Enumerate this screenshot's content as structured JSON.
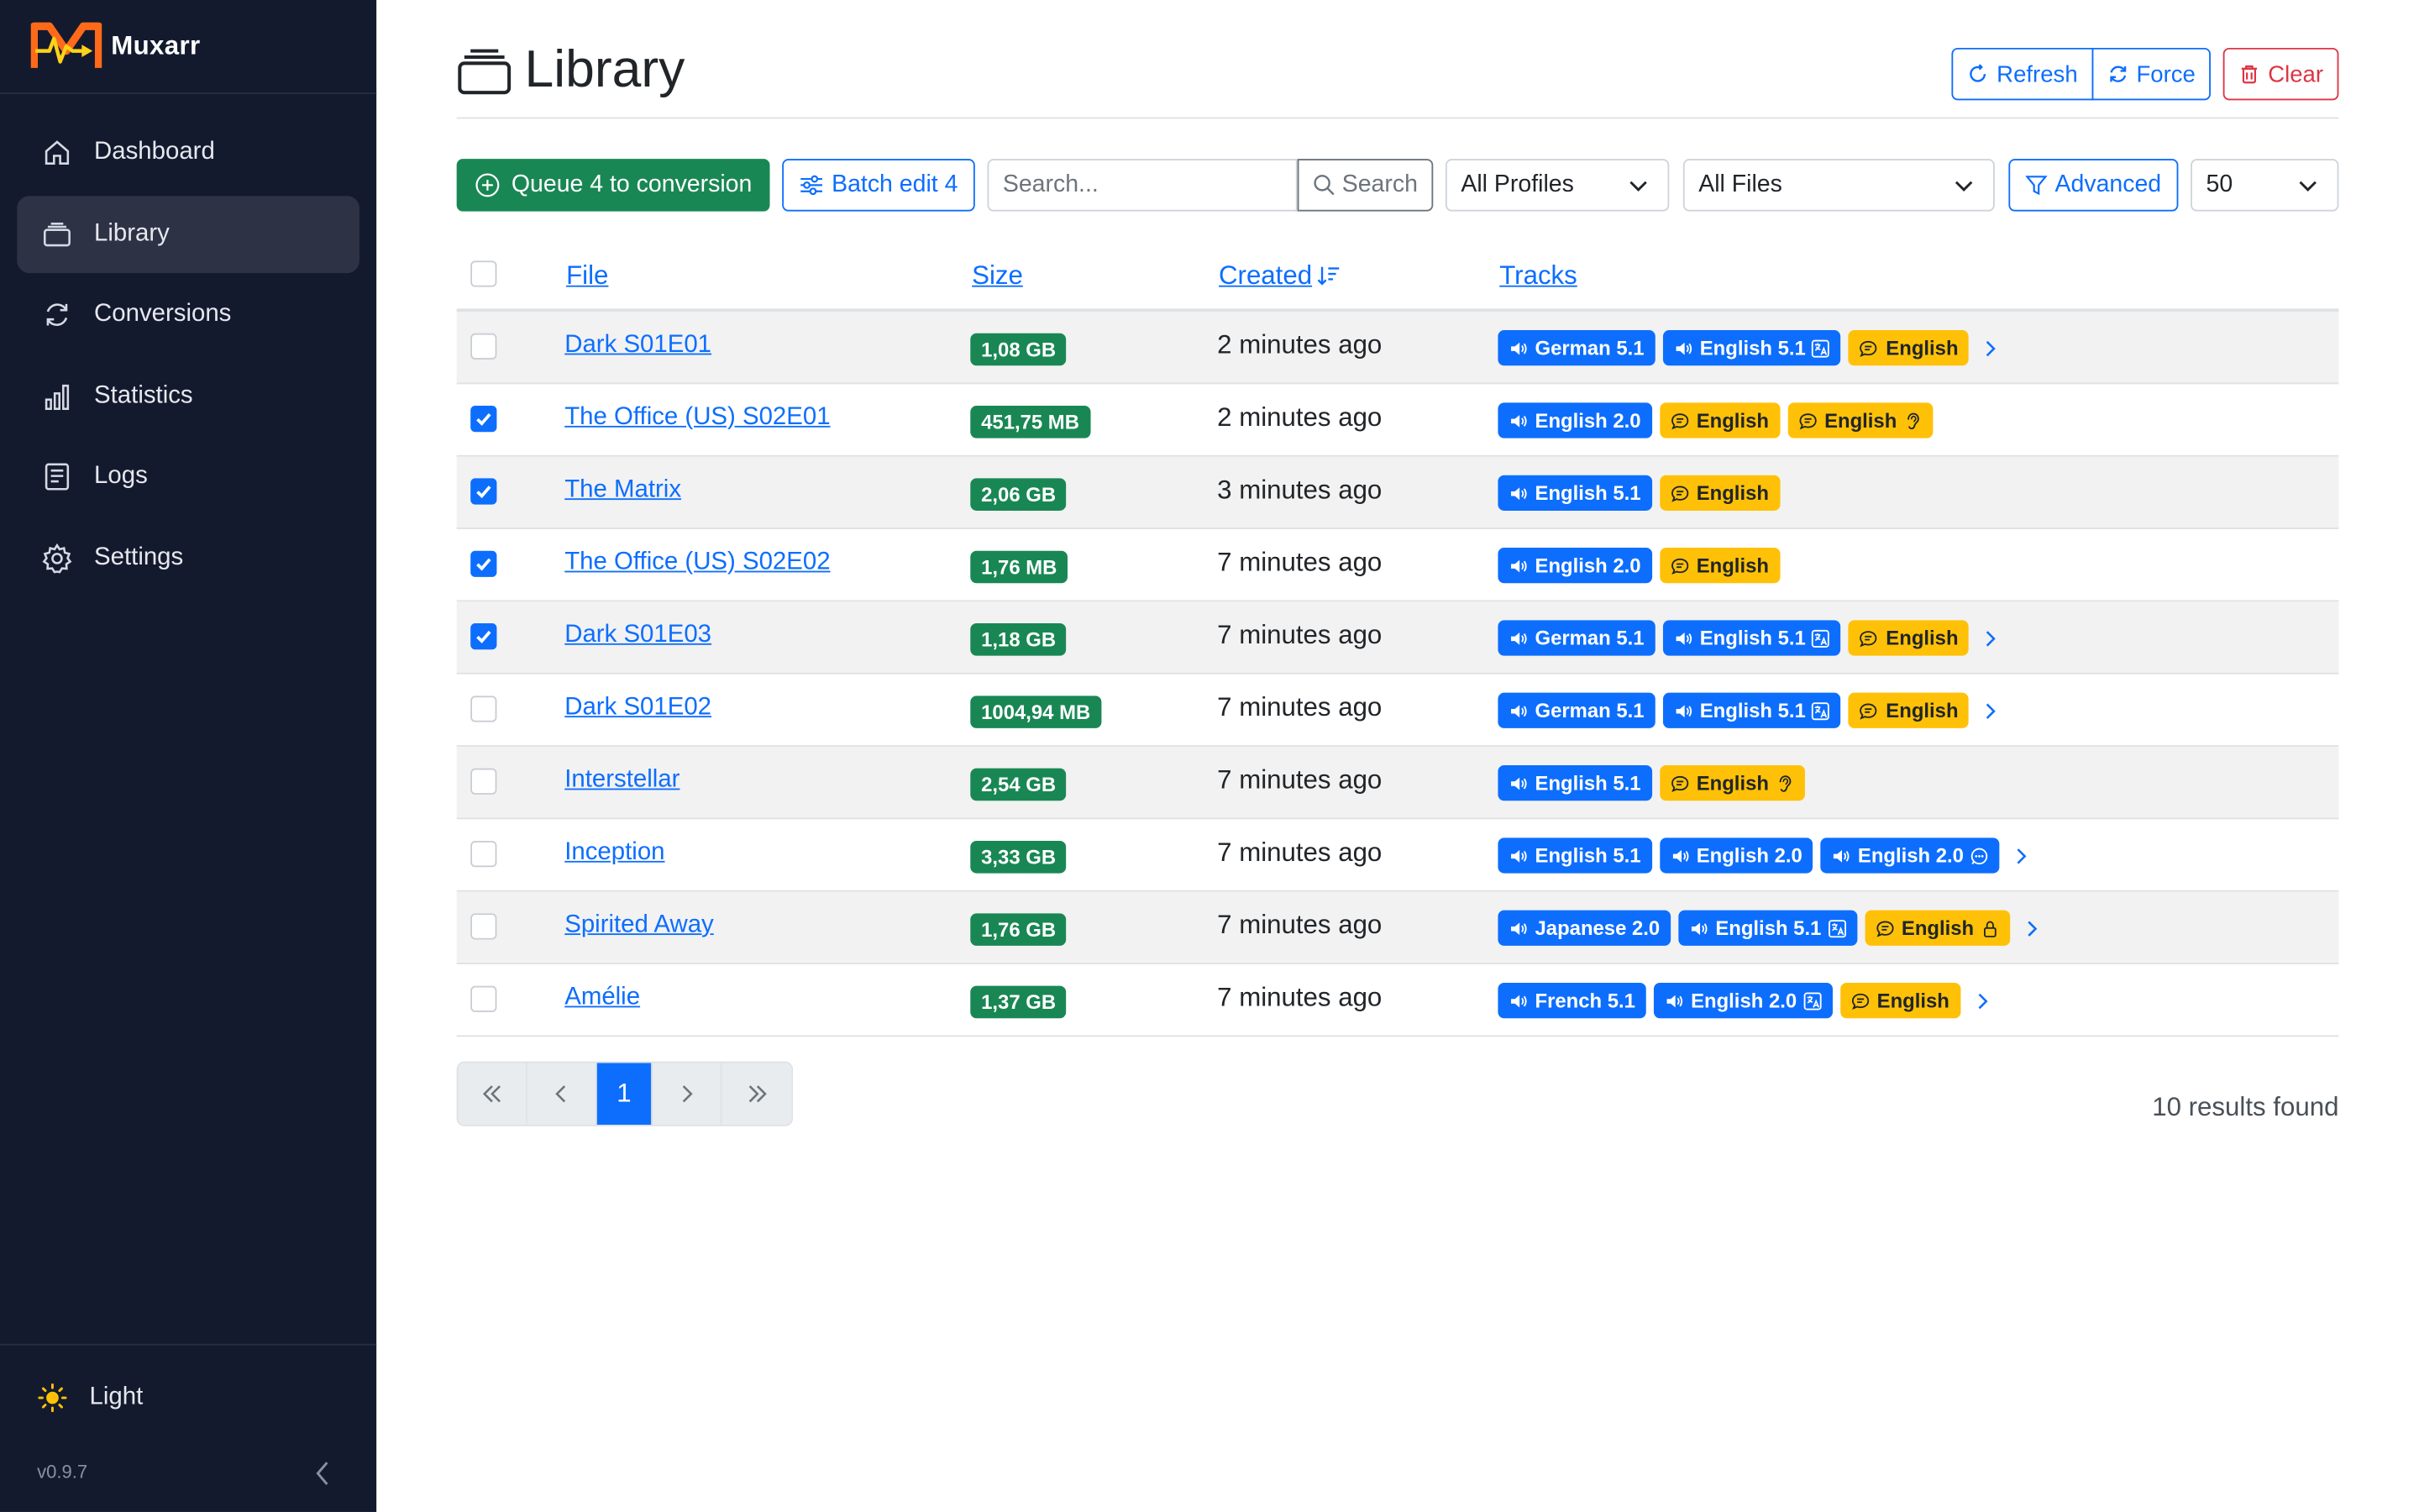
{
  "app": {
    "name": "Muxarr",
    "version": "v0.9.7"
  },
  "sidebar": {
    "items": [
      {
        "label": "Dashboard",
        "icon": "home-icon"
      },
      {
        "label": "Library",
        "icon": "library-icon",
        "active": true
      },
      {
        "label": "Conversions",
        "icon": "refresh-icon"
      },
      {
        "label": "Statistics",
        "icon": "bar-chart-icon"
      },
      {
        "label": "Logs",
        "icon": "log-file-icon"
      },
      {
        "label": "Settings",
        "icon": "gear-icon"
      }
    ],
    "theme_label": "Light"
  },
  "page": {
    "title": "Library"
  },
  "header_buttons": {
    "refresh": "Refresh",
    "force": "Force",
    "clear": "Clear"
  },
  "toolbar": {
    "queue_label": "Queue 4 to conversion",
    "batch_label": "Batch edit 4",
    "search_placeholder": "Search...",
    "search_button": "Search",
    "profiles_select": "All Profiles",
    "files_select": "All Files",
    "advanced_label": "Advanced",
    "page_size": "50"
  },
  "table": {
    "columns": {
      "file": "File",
      "size": "Size",
      "created": "Created",
      "tracks": "Tracks"
    },
    "rows": [
      {
        "checked": false,
        "file": "Dark S01E01",
        "size": "1,08 GB",
        "created": "2 minutes ago",
        "more": true,
        "tracks": [
          {
            "type": "audio",
            "label": "German 5.1"
          },
          {
            "type": "audio",
            "label": "English 5.1",
            "flag": "translate-icon"
          },
          {
            "type": "sub",
            "label": "English"
          }
        ]
      },
      {
        "checked": true,
        "file": "The Office (US) S02E01",
        "size": "451,75 MB",
        "created": "2 minutes ago",
        "more": false,
        "tracks": [
          {
            "type": "audio",
            "label": "English 2.0"
          },
          {
            "type": "sub",
            "label": "English"
          },
          {
            "type": "sub",
            "label": "English",
            "flag": "ear-icon"
          }
        ]
      },
      {
        "checked": true,
        "file": "The Matrix",
        "size": "2,06 GB",
        "created": "3 minutes ago",
        "more": false,
        "tracks": [
          {
            "type": "audio",
            "label": "English 5.1"
          },
          {
            "type": "sub",
            "label": "English"
          }
        ]
      },
      {
        "checked": true,
        "file": "The Office (US) S02E02",
        "size": "1,76 MB",
        "created": "7 minutes ago",
        "more": false,
        "tracks": [
          {
            "type": "audio",
            "label": "English 2.0"
          },
          {
            "type": "sub",
            "label": "English"
          }
        ]
      },
      {
        "checked": true,
        "file": "Dark S01E03",
        "size": "1,18 GB",
        "created": "7 minutes ago",
        "more": true,
        "tracks": [
          {
            "type": "audio",
            "label": "German 5.1"
          },
          {
            "type": "audio",
            "label": "English 5.1",
            "flag": "translate-icon"
          },
          {
            "type": "sub",
            "label": "English"
          }
        ]
      },
      {
        "checked": false,
        "file": "Dark S01E02",
        "size": "1004,94 MB",
        "created": "7 minutes ago",
        "more": true,
        "tracks": [
          {
            "type": "audio",
            "label": "German 5.1"
          },
          {
            "type": "audio",
            "label": "English 5.1",
            "flag": "translate-icon"
          },
          {
            "type": "sub",
            "label": "English"
          }
        ]
      },
      {
        "checked": false,
        "file": "Interstellar",
        "size": "2,54 GB",
        "created": "7 minutes ago",
        "more": false,
        "tracks": [
          {
            "type": "audio",
            "label": "English 5.1"
          },
          {
            "type": "sub",
            "label": "English",
            "flag": "ear-icon"
          }
        ]
      },
      {
        "checked": false,
        "file": "Inception",
        "size": "3,33 GB",
        "created": "7 minutes ago",
        "more": true,
        "tracks": [
          {
            "type": "audio",
            "label": "English 5.1"
          },
          {
            "type": "audio",
            "label": "English 2.0"
          },
          {
            "type": "audio",
            "label": "English 2.0",
            "flag": "commentary-icon"
          }
        ]
      },
      {
        "checked": false,
        "file": "Spirited Away",
        "size": "1,76 GB",
        "created": "7 minutes ago",
        "more": true,
        "tracks": [
          {
            "type": "audio",
            "label": "Japanese 2.0"
          },
          {
            "type": "audio",
            "label": "English 5.1",
            "flag": "translate-icon"
          },
          {
            "type": "sub",
            "label": "English",
            "flag": "lock-icon"
          }
        ]
      },
      {
        "checked": false,
        "file": "Amélie",
        "size": "1,37 GB",
        "created": "7 minutes ago",
        "more": true,
        "tracks": [
          {
            "type": "audio",
            "label": "French 5.1"
          },
          {
            "type": "audio",
            "label": "English 2.0",
            "flag": "translate-icon"
          },
          {
            "type": "sub",
            "label": "English"
          }
        ]
      }
    ]
  },
  "pagination": {
    "current": "1"
  },
  "results_text": "10 results found",
  "colors": {
    "primary": "#0d6efd",
    "success": "#198754",
    "warning": "#ffc107",
    "danger": "#dc3545",
    "sidebar": "#141a2e"
  }
}
